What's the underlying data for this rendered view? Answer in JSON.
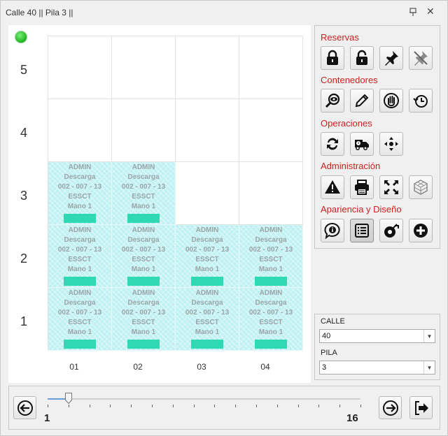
{
  "window": {
    "title": "Calle 40 || Pila 3 ||"
  },
  "grid": {
    "rows": [
      "5",
      "4",
      "3",
      "2",
      "1"
    ],
    "columns": [
      "01",
      "02",
      "03",
      "04"
    ],
    "filled": [
      {
        "row": 3,
        "col": 1
      },
      {
        "row": 3,
        "col": 2
      },
      {
        "row": 2,
        "col": 1
      },
      {
        "row": 2,
        "col": 2
      },
      {
        "row": 2,
        "col": 3
      },
      {
        "row": 2,
        "col": 4
      },
      {
        "row": 1,
        "col": 1
      },
      {
        "row": 1,
        "col": 2
      },
      {
        "row": 1,
        "col": 3
      },
      {
        "row": 1,
        "col": 4
      }
    ],
    "container_text": {
      "user": "ADMIN",
      "operation": "Descarga",
      "position": "002 - 007 - 13",
      "company": "ESSCT",
      "crane": "Mano 1"
    }
  },
  "toolbar": {
    "sections": {
      "reservas": "Reservas",
      "contenedores": "Contenedores",
      "operaciones": "Operaciones",
      "administracion": "Administración",
      "apariencia": "Apariencia y Diseño"
    },
    "icons": {
      "reservas": [
        "lock-icon",
        "unlock-icon",
        "pin-icon",
        "unpin-icon"
      ],
      "contenedores": [
        "view-icon",
        "edit-icon",
        "hand-stop-icon",
        "history-icon"
      ],
      "operaciones": [
        "swap-icon",
        "delivery-truck-icon",
        "move-icon"
      ],
      "administracion": [
        "warning-icon",
        "print-icon",
        "fullscreen-icon",
        "cube-icon"
      ],
      "apariencia": [
        "info-icon",
        "list-icon",
        "tape-icon",
        "add-icon"
      ]
    }
  },
  "selectors": {
    "calle_label": "CALLE",
    "calle_value": "40",
    "pila_label": "PILA",
    "pila_value": "3"
  },
  "slider": {
    "min": "1",
    "max": "16",
    "value": 2,
    "ticks": 16
  },
  "colors": {
    "container_fill": "#bff1f3",
    "container_bar": "#2ed9b3",
    "section_title": "#cc1f1f",
    "status_ok": "#23b823"
  }
}
